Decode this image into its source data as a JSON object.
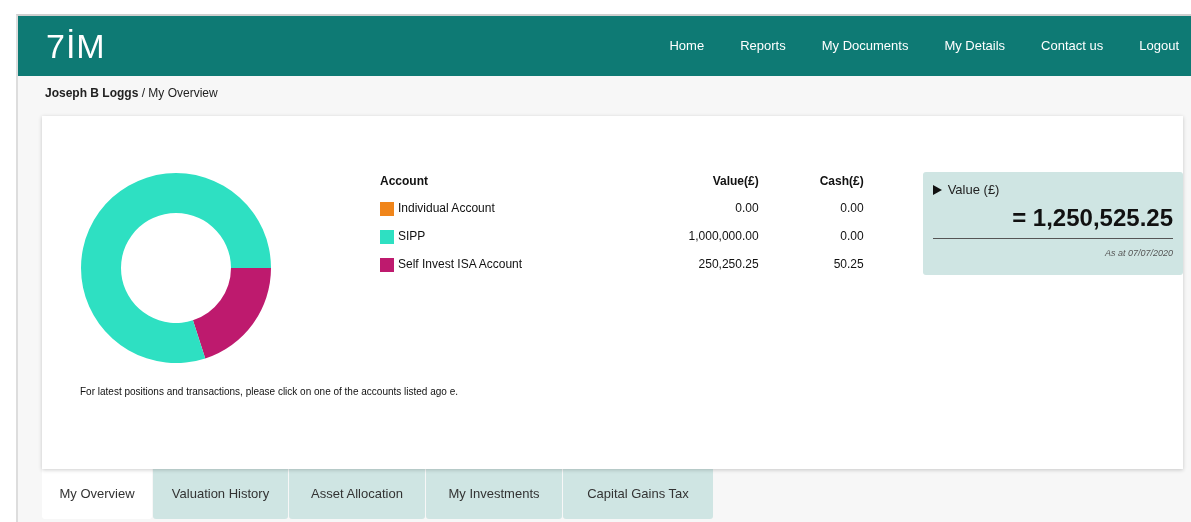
{
  "header": {
    "logo": "7İM",
    "nav": [
      {
        "label": "Home"
      },
      {
        "label": "Reports"
      },
      {
        "label": "My Documents"
      },
      {
        "label": "My Details"
      },
      {
        "label": "Contact us"
      },
      {
        "label": "Logout"
      }
    ]
  },
  "breadcrumb": {
    "user": "Joseph B Loggs",
    "page": "/ My Overview"
  },
  "accounts": {
    "columns": [
      "Account",
      "Value(£)",
      "Cash(£)"
    ],
    "rows": [
      {
        "name": "Individual Account",
        "value": "0.00",
        "cash": "0.00",
        "color": "#f0851a"
      },
      {
        "name": "SIPP",
        "value": "1,000,000.00",
        "cash": "0.00",
        "color": "#2ee0c2"
      },
      {
        "name": "Self Invest ISA Account",
        "value": "250,250.25",
        "cash": "50.25",
        "color": "#be1a6e"
      }
    ]
  },
  "total": {
    "label": "Value (£)",
    "amount": "= 1,250,525.25",
    "as_at": "As at 07/07/2020"
  },
  "note": "For latest positions and transactions, please click on one of the accounts listed ago e.",
  "tabs": [
    {
      "label": "My Overview",
      "selected": true
    },
    {
      "label": "Valuation History",
      "selected": false
    },
    {
      "label": "Asset Allocation",
      "selected": false
    },
    {
      "label": "My Investments",
      "selected": false
    },
    {
      "label": "Capital Gains Tax",
      "selected": false
    }
  ]
}
